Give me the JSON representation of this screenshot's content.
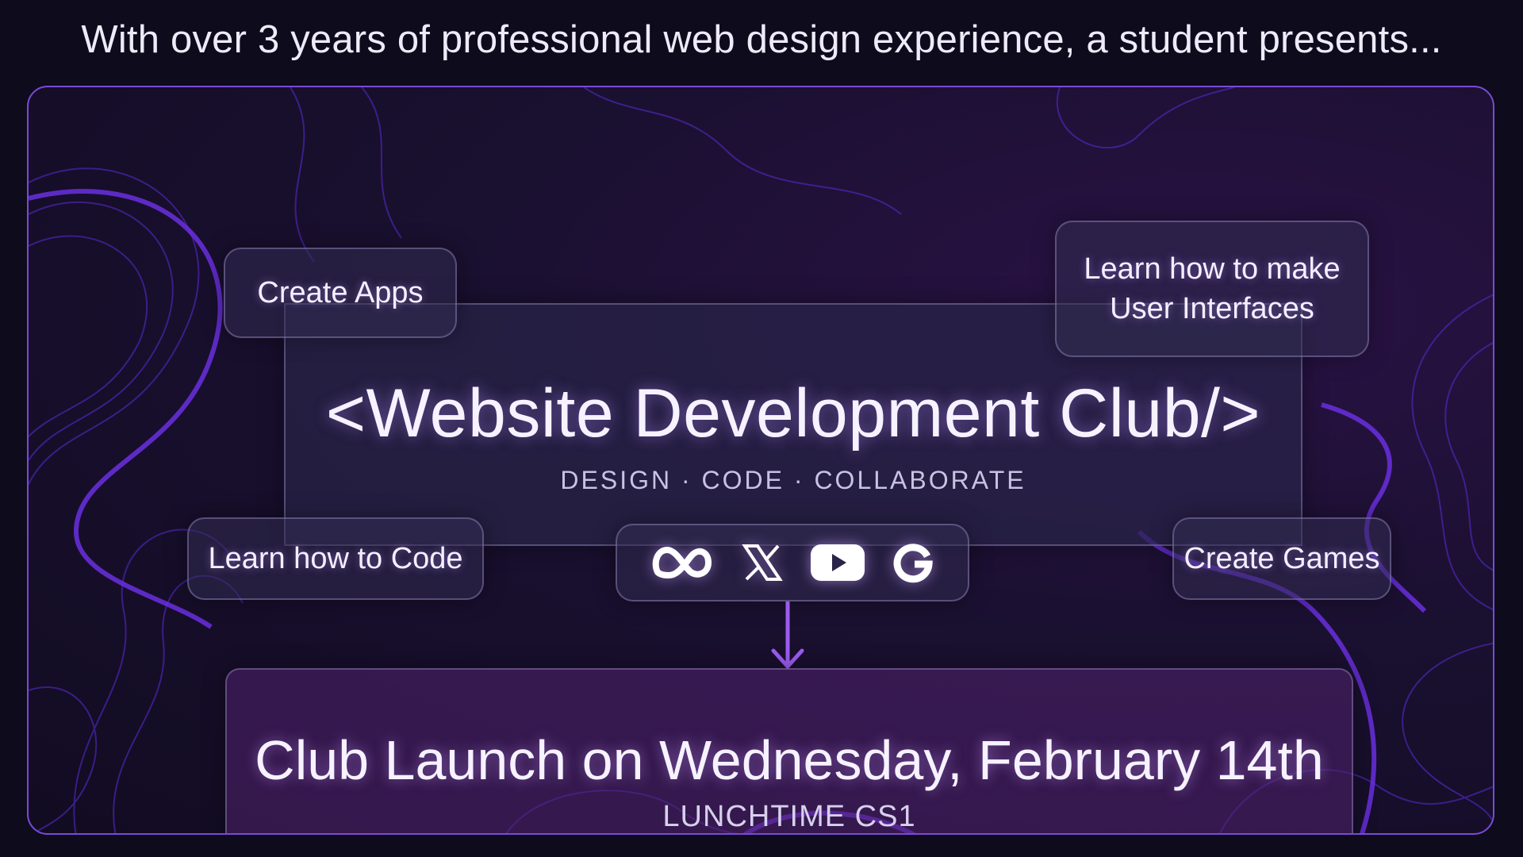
{
  "header": {
    "tagline": "With over 3 years of professional web design experience, a student presents..."
  },
  "main": {
    "title": "<Website Development Club/>",
    "subtitle": "DESIGN · CODE · COLLABORATE"
  },
  "features": {
    "create_apps": "Create Apps",
    "learn_ui_line1": "Learn how to make",
    "learn_ui_line2": "User Interfaces",
    "learn_code": "Learn how to Code",
    "create_games": "Create Games"
  },
  "brand_icons": [
    "meta-icon",
    "x-icon",
    "youtube-icon",
    "google-icon"
  ],
  "launch": {
    "title": "Club Launch on Wednesday, February 14th",
    "location": "LUNCHTIME CS1"
  },
  "colors": {
    "background": "#0d0b1c",
    "accent": "#7a4ad6",
    "contour": "#6a2fe0",
    "text": "#f1ecff"
  }
}
